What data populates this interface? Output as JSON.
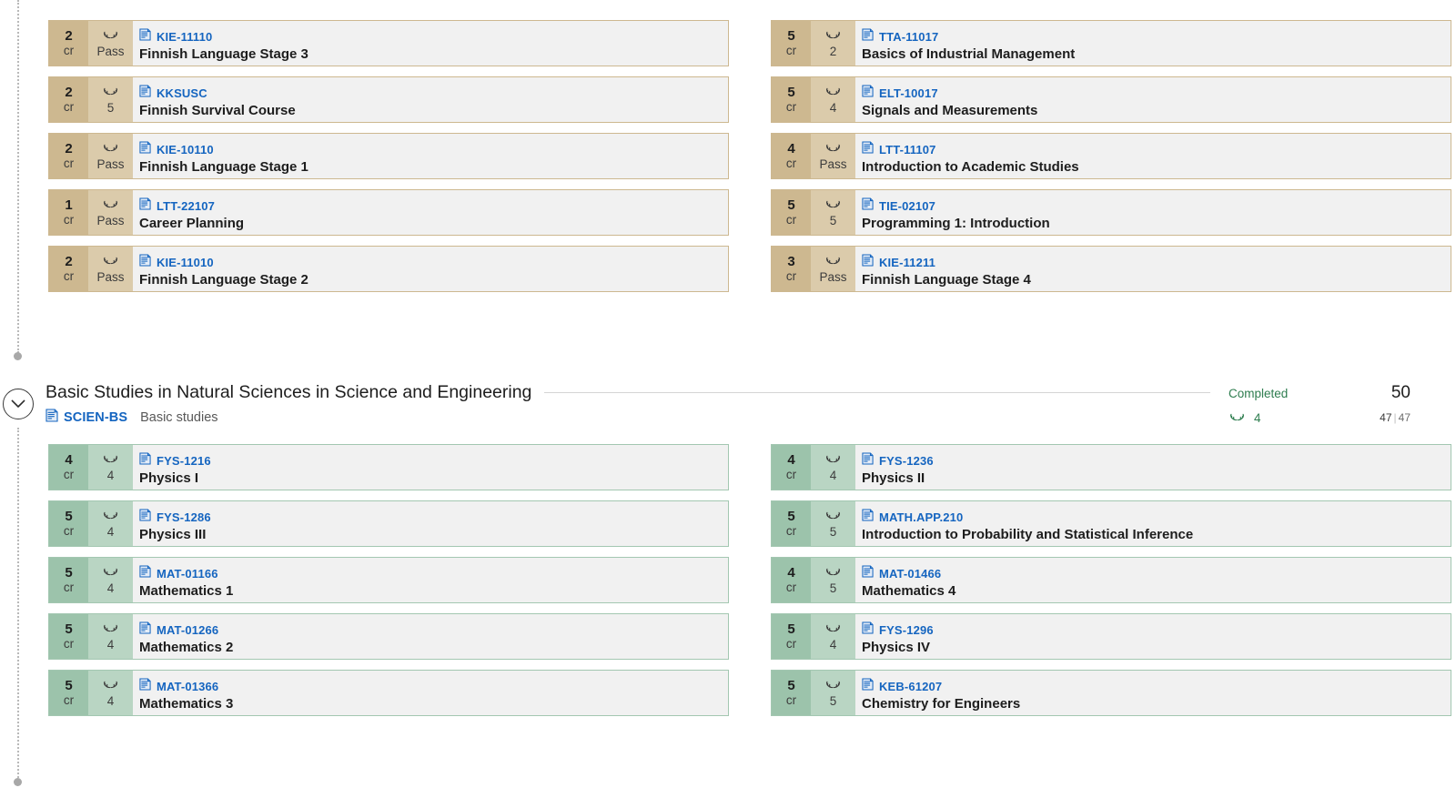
{
  "icons": {
    "document": "document-icon",
    "grade": "laurel-wreath-icon",
    "collapse": "chevron-down-icon"
  },
  "colors": {
    "tan_accent": "#cdb890",
    "tan_accent_light": "#dbcbab",
    "green_accent": "#9cc3ab",
    "green_accent_light": "#b9d5c3",
    "card_body": "#f1f1f1",
    "link_blue": "#1565c0",
    "status_green": "#2e7d4f"
  },
  "units": {
    "credit_abbrev": "cr"
  },
  "tan_section": {
    "courses": [
      {
        "credits": "2",
        "unit": "cr",
        "grade": "Pass",
        "code": "KIE-11110",
        "name": "Finnish Language Stage 3"
      },
      {
        "credits": "5",
        "unit": "cr",
        "grade": "2",
        "code": "TTA-11017",
        "name": "Basics of Industrial Management"
      },
      {
        "credits": "2",
        "unit": "cr",
        "grade": "5",
        "code": "KKSUSC",
        "name": "Finnish Survival Course"
      },
      {
        "credits": "5",
        "unit": "cr",
        "grade": "4",
        "code": "ELT-10017",
        "name": "Signals and Measurements"
      },
      {
        "credits": "2",
        "unit": "cr",
        "grade": "Pass",
        "code": "KIE-10110",
        "name": "Finnish Language Stage 1"
      },
      {
        "credits": "4",
        "unit": "cr",
        "grade": "Pass",
        "code": "LTT-11107",
        "name": "Introduction to Academic Studies"
      },
      {
        "credits": "1",
        "unit": "cr",
        "grade": "Pass",
        "code": "LTT-22107",
        "name": "Career Planning"
      },
      {
        "credits": "5",
        "unit": "cr",
        "grade": "5",
        "code": "TIE-02107",
        "name": "Programming 1: Introduction"
      },
      {
        "credits": "2",
        "unit": "cr",
        "grade": "Pass",
        "code": "KIE-11010",
        "name": "Finnish Language Stage 2"
      },
      {
        "credits": "3",
        "unit": "cr",
        "grade": "Pass",
        "code": "KIE-11211",
        "name": "Finnish Language Stage 4"
      }
    ]
  },
  "group": {
    "title": "Basic Studies in Natural Sciences in Science and Engineering",
    "code": "SCIEN-BS",
    "type": "Basic studies",
    "status": "Completed",
    "grade": "4",
    "total": "50",
    "completed": "47",
    "required": "47",
    "ratio_separator": "|"
  },
  "green_section": {
    "courses": [
      {
        "credits": "4",
        "unit": "cr",
        "grade": "4",
        "code": "FYS-1216",
        "name": "Physics I"
      },
      {
        "credits": "4",
        "unit": "cr",
        "grade": "4",
        "code": "FYS-1236",
        "name": "Physics II"
      },
      {
        "credits": "5",
        "unit": "cr",
        "grade": "4",
        "code": "FYS-1286",
        "name": "Physics III"
      },
      {
        "credits": "5",
        "unit": "cr",
        "grade": "5",
        "code": "MATH.APP.210",
        "name": "Introduction to Probability and Statistical Inference"
      },
      {
        "credits": "5",
        "unit": "cr",
        "grade": "4",
        "code": "MAT-01166",
        "name": "Mathematics 1"
      },
      {
        "credits": "4",
        "unit": "cr",
        "grade": "5",
        "code": "MAT-01466",
        "name": "Mathematics 4"
      },
      {
        "credits": "5",
        "unit": "cr",
        "grade": "4",
        "code": "MAT-01266",
        "name": "Mathematics 2"
      },
      {
        "credits": "5",
        "unit": "cr",
        "grade": "4",
        "code": "FYS-1296",
        "name": "Physics IV"
      },
      {
        "credits": "5",
        "unit": "cr",
        "grade": "4",
        "code": "MAT-01366",
        "name": "Mathematics 3"
      },
      {
        "credits": "5",
        "unit": "cr",
        "grade": "5",
        "code": "KEB-61207",
        "name": "Chemistry for Engineers"
      }
    ]
  }
}
